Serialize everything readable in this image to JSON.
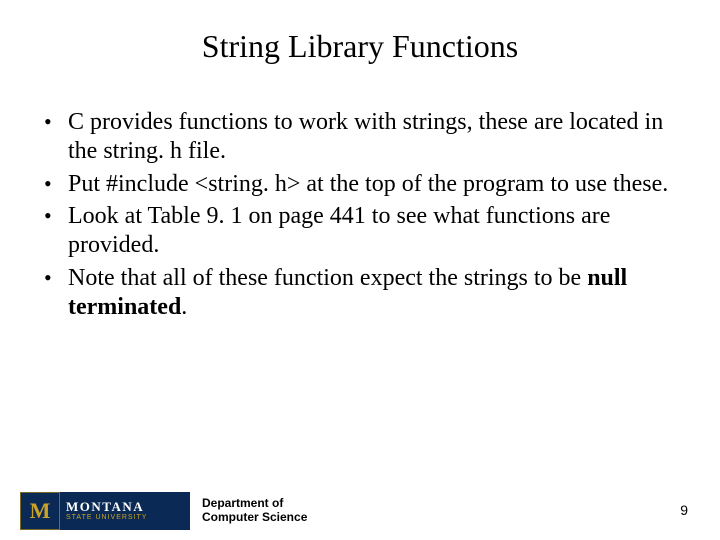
{
  "title": "String Library Functions",
  "bullets": [
    {
      "pre": "C provides functions to work with strings, these are located in the string. h file.",
      "bold": "",
      "post": ""
    },
    {
      "pre": "Put #include <string. h> at the top of the program to use these.",
      "bold": "",
      "post": ""
    },
    {
      "pre": "Look at Table 9. 1 on page 441 to see what functions are provided.",
      "bold": "",
      "post": ""
    },
    {
      "pre": "Note that all of these function expect the strings to be ",
      "bold": "null terminated",
      "post": "."
    }
  ],
  "footer": {
    "logo": {
      "letter": "M",
      "word": "MONTANA",
      "sub": "STATE UNIVERSITY"
    },
    "dept_line1": "Department of",
    "dept_line2": "Computer Science"
  },
  "page_number": "9"
}
